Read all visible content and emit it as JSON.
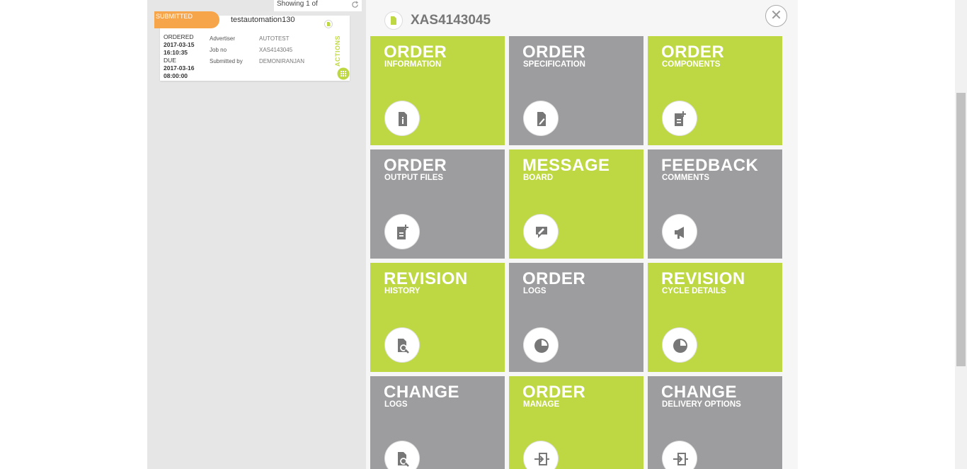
{
  "list": {
    "showing_text": "Showing 1 of",
    "refresh_icon": "refresh-icon"
  },
  "card": {
    "status": "SUBMITTED",
    "title": "testautomation130",
    "ordered_label": "ORDERED",
    "ordered_date": "2017-03-15",
    "ordered_time": "16:10:35",
    "due_label": "DUE",
    "due_date": "2017-03-16",
    "due_time": "08:00:00",
    "advertiser_label": "Advertiser",
    "advertiser_value": "AUTOTEST",
    "jobno_label": "Job no",
    "jobno_value": "XAS4143045",
    "submitted_label": "Submitted by",
    "submitted_value": "DEMONIRANJAN",
    "actions_label": "ACTIONS"
  },
  "detail": {
    "title": "XAS4143045",
    "close_icon": "close-icon"
  },
  "colors": {
    "green": "#bed844",
    "gray": "#9d9d9f",
    "status_orange": "#f7a54a"
  },
  "tiles": [
    {
      "title": "ORDER",
      "sub": "INFORMATION",
      "color": "green",
      "icon": "info-document-icon"
    },
    {
      "title": "ORDER",
      "sub": "SPECIFICATION",
      "color": "gray",
      "icon": "edit-document-icon"
    },
    {
      "title": "ORDER",
      "sub": "COMPONENTS",
      "color": "green",
      "icon": "add-document-icon"
    },
    {
      "title": "ORDER",
      "sub": "OUTPUT FILES",
      "color": "gray",
      "icon": "add-document-icon"
    },
    {
      "title": "MESSAGE",
      "sub": "BOARD",
      "color": "green",
      "icon": "message-icon"
    },
    {
      "title": "FEEDBACK",
      "sub": "COMMENTS",
      "color": "gray",
      "icon": "megaphone-icon"
    },
    {
      "title": "REVISION",
      "sub": "HISTORY",
      "color": "green",
      "icon": "search-document-icon"
    },
    {
      "title": "ORDER",
      "sub": "LOGS",
      "color": "gray",
      "icon": "clock-icon"
    },
    {
      "title": "REVISION",
      "sub": "CYCLE DETAILS",
      "color": "green",
      "icon": "clock-icon"
    },
    {
      "title": "CHANGE",
      "sub": "LOGS",
      "color": "gray",
      "icon": "search-document-icon"
    },
    {
      "title": "ORDER",
      "sub": "MANAGE",
      "color": "green",
      "icon": "transfer-icon"
    },
    {
      "title": "CHANGE",
      "sub": "DELIVERY OPTIONS",
      "color": "gray",
      "icon": "transfer-icon"
    }
  ]
}
